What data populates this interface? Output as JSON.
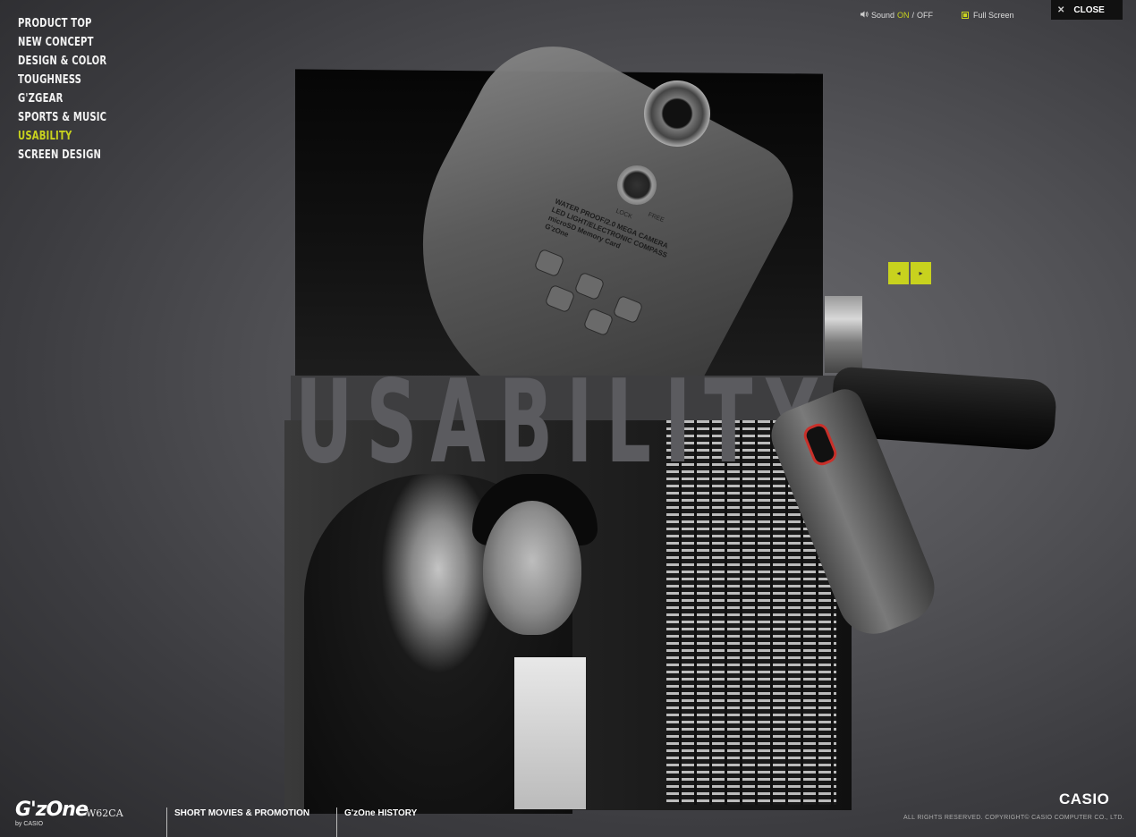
{
  "nav": {
    "items": [
      {
        "label": "PRODUCT TOP"
      },
      {
        "label": "NEW CONCEPT"
      },
      {
        "label": "DESIGN & COLOR"
      },
      {
        "label": "TOUGHNESS"
      },
      {
        "label": "G'zGEAR"
      },
      {
        "label": "SPORTS & MUSIC"
      },
      {
        "label": "USABILITY",
        "active": true
      },
      {
        "label": "SCREEN DESIGN"
      }
    ]
  },
  "top_controls": {
    "sound_label": "Sound",
    "sound_on": "ON",
    "sound_separator": "/",
    "sound_off": "OFF",
    "fullscreen_label": "Full Screen",
    "close_label": "CLOSE"
  },
  "hero": {
    "title": "USABILITY",
    "phone_printed_text": [
      "WATER PROOF/2.0 MEGA CAMERA",
      "LED LIGHT/ELECTRONIC COMPASS",
      "microSD Memory Card",
      "G'zOne"
    ],
    "lock_label": "LOCK",
    "free_label": "FREE"
  },
  "gallery_nav": {
    "prev_icon": "◂",
    "next_icon": "▸"
  },
  "footer": {
    "logo_text": "G'zOne",
    "model": "W62CA",
    "by": "by CASIO",
    "links": [
      "SHORT MOVIES & PROMOTION",
      "G'zOne HISTORY"
    ],
    "brand": "CASIO",
    "copyright": "ALL RIGHTS RESERVED. COPYRIGHT© CASIO COMPUTER CO., LTD."
  },
  "colors": {
    "accent": "#c8d21e",
    "background": "#4a4a4e",
    "close_bg": "#111111"
  }
}
